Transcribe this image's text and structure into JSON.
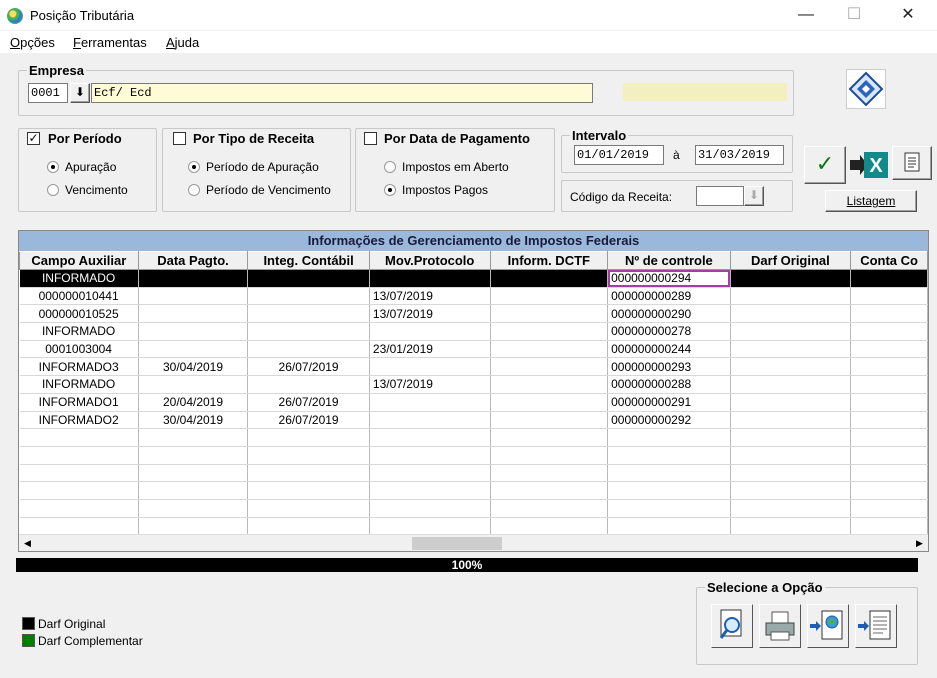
{
  "window": {
    "title": "Posição Tributária",
    "minimize": "—",
    "maximize": "☐",
    "close": "✕"
  },
  "menu": [
    {
      "u": "O",
      "rest": "pções"
    },
    {
      "u": "F",
      "rest": "erramentas"
    },
    {
      "u": "A",
      "rest": "juda"
    }
  ],
  "empresa": {
    "label": "Empresa",
    "code": "0001",
    "name": "Ecf/ Ecd"
  },
  "period_group": {
    "label": "Por Período",
    "checked": true,
    "options": [
      {
        "label": "Apuração",
        "selected": true
      },
      {
        "label": "Vencimento",
        "selected": false
      }
    ]
  },
  "tipo_group": {
    "label": "Por Tipo de Receita",
    "checked": false,
    "options": [
      {
        "label": "Período de Apuração",
        "selected": true
      },
      {
        "label": "Período de Vencimento",
        "selected": false
      }
    ]
  },
  "pagamento_group": {
    "label": "Por Data de Pagamento",
    "checked": false,
    "options": [
      {
        "label": "Impostos em Aberto",
        "selected": false
      },
      {
        "label": "Impostos Pagos",
        "selected": true
      }
    ]
  },
  "intervalo": {
    "label": "Intervalo",
    "start": "01/01/2019",
    "sep": "à",
    "end": "31/03/2019"
  },
  "codigo_receita": {
    "label": "Código da Receita:",
    "value": ""
  },
  "listagem_label": "Listagem",
  "grid": {
    "caption": "Informações de Gerenciamento de Impostos Federais",
    "columns": [
      "Campo Auxiliar",
      "Data Pagto.",
      "Integ. Contábil",
      "Mov.Protocolo",
      "Inform. DCTF",
      "Nº de controle",
      "Darf Original",
      "Conta Co"
    ],
    "rows": [
      [
        "INFORMADO",
        "",
        "",
        "",
        "",
        "000000000294",
        "",
        ""
      ],
      [
        "000000010441",
        "",
        "",
        "13/07/2019",
        "",
        "000000000289",
        "",
        ""
      ],
      [
        "000000010525",
        "",
        "",
        "13/07/2019",
        "",
        "000000000290",
        "",
        ""
      ],
      [
        "INFORMADO",
        "",
        "",
        "",
        "",
        "000000000278",
        "",
        ""
      ],
      [
        "0001003004",
        "",
        "",
        "23/01/2019",
        "",
        "000000000244",
        "",
        ""
      ],
      [
        "INFORMADO3",
        "30/04/2019",
        "26/07/2019",
        "",
        "",
        "000000000293",
        "",
        ""
      ],
      [
        "INFORMADO",
        "",
        "",
        "13/07/2019",
        "",
        "000000000288",
        "",
        ""
      ],
      [
        "INFORMADO1",
        "20/04/2019",
        "26/07/2019",
        "",
        "",
        "000000000291",
        "",
        ""
      ],
      [
        "INFORMADO2",
        "30/04/2019",
        "26/07/2019",
        "",
        "",
        "000000000292",
        "",
        ""
      ]
    ],
    "selected_row": 0,
    "empty_rows": 6
  },
  "progress": {
    "label": "100%",
    "value": 1.0
  },
  "legend": [
    {
      "label": "Darf Original",
      "color": "#000000"
    },
    {
      "label": "Darf Complementar",
      "color": "#008000"
    }
  ],
  "options_group": {
    "label": "Selecione a Opção"
  },
  "colors": {
    "caption_bg": "#9ab8dc",
    "field_yellow": "#fffbd6",
    "focus_outline": "#a040a0"
  }
}
